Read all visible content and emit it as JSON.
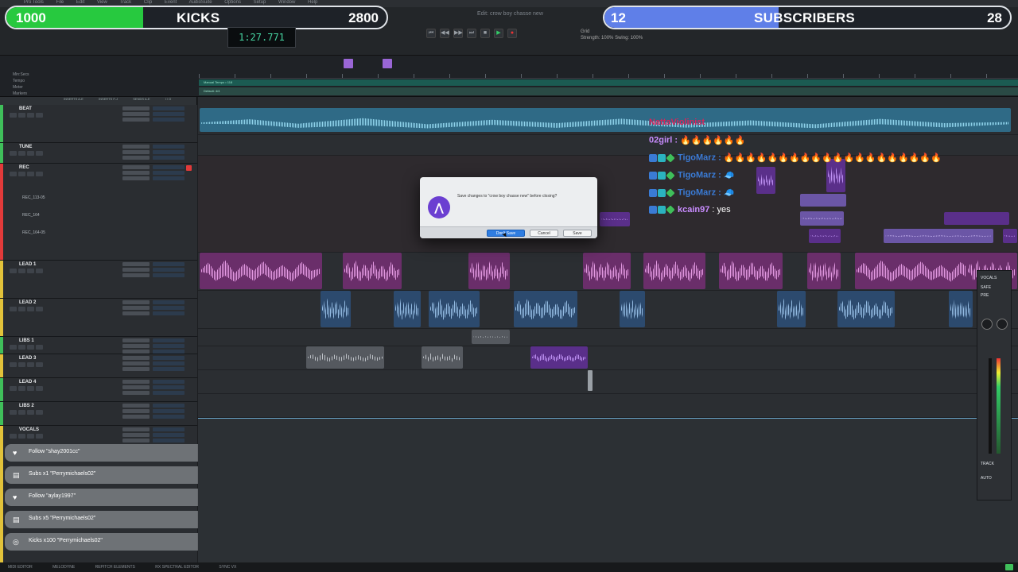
{
  "menu": [
    "Pro Tools",
    "File",
    "Edit",
    "View",
    "Track",
    "Clip",
    "Event",
    "AudioSuite",
    "Options",
    "Setup",
    "Window",
    "Help"
  ],
  "stats_left": {
    "left_value": "1000",
    "label": "KICKS",
    "right_value": "2800",
    "progress": 0.36,
    "color": "#27c93f"
  },
  "stats_right": {
    "left_value": "12",
    "label": "SUBSCRIBERS",
    "right_value": "28",
    "progress": 0.43,
    "color": "#5f7fe8"
  },
  "session_title": "Edit: crow boy chasse new",
  "main_counter": "1:27.771",
  "transport": [
    "⏮",
    "◀◀",
    "▶▶",
    "⏭",
    "■",
    "▶",
    "●"
  ],
  "grid_readout": [
    "Grid",
    "Strength:",
    "100%",
    "Swing:",
    "100%"
  ],
  "ruler_rows": [
    "Min:Secs",
    "Tempo",
    "Meter",
    "Markers"
  ],
  "ruler_sub": [
    "Manual Tempo • 118",
    "Default: 4/4"
  ],
  "mixer_columns": [
    "INSERTS A-E",
    "INSERTS F-J",
    "SENDS A-E",
    "I / O"
  ],
  "tracks": [
    {
      "name": "BEAT",
      "color": "#3fbf5a",
      "subs": []
    },
    {
      "name": "TUNE",
      "color": "#3fbf5a",
      "subs": []
    },
    {
      "name": "REC",
      "color": "#e23a3a",
      "subs": [
        "REC_113-05",
        "REC_164",
        "REC_164-05"
      ]
    },
    {
      "name": "LEAD 1",
      "color": "#e2c23a",
      "subs": []
    },
    {
      "name": "LEAD 2",
      "color": "#e2c23a",
      "subs": []
    },
    {
      "name": "LIBS 1",
      "color": "#3fbf5a",
      "subs": []
    },
    {
      "name": "LEAD 3",
      "color": "#e2c23a",
      "subs": []
    },
    {
      "name": "LEAD 4",
      "color": "#3fbf5a",
      "subs": []
    },
    {
      "name": "LIBS 2",
      "color": "#3fbf5a",
      "subs": []
    },
    {
      "name": "VOCALS",
      "color": "#e2c23a",
      "subs": []
    }
  ],
  "alerts": [
    {
      "icon": "heart-icon",
      "glyph": "♥",
      "text": "Follow \"shay2001cc\""
    },
    {
      "icon": "gift-icon",
      "glyph": "▤",
      "text": "Subs x1 \"Perrymichaels02\""
    },
    {
      "icon": "heart-icon",
      "glyph": "♥",
      "text": "Follow \"aylay1997\""
    },
    {
      "icon": "gift-icon",
      "glyph": "▤",
      "text": "Subs x5 \"Perrymichaels02\""
    },
    {
      "icon": "kick-icon",
      "glyph": "◎",
      "text": "Kicks x100 \"Perrymichaels02\""
    }
  ],
  "chat": [
    {
      "user": "NattaViolinist",
      "color": "#d9245b",
      "message": "",
      "badges": 0
    },
    {
      "user": "02girl",
      "color": "#c98cff",
      "message": "🔥🔥🔥🔥🔥🔥",
      "badges": 0
    },
    {
      "user": "TigoMarz",
      "color": "#3a7bd5",
      "message": "🔥🔥🔥🔥🔥🔥🔥🔥🔥🔥🔥🔥🔥🔥🔥🔥🔥🔥🔥🔥",
      "badges": 3
    },
    {
      "user": "TigoMarz",
      "color": "#3a7bd5",
      "message": "🧢",
      "badges": 3
    },
    {
      "user": "TigoMarz",
      "color": "#3a7bd5",
      "message": "🧢",
      "badges": 3
    },
    {
      "user": "kcain97",
      "color": "#c98cff",
      "message": "yes",
      "badges": 3
    }
  ],
  "dialog": {
    "message": "Save changes to \"crow boy chasse new\" before closing?",
    "dont_save": "Don't Save",
    "cancel": "Cancel",
    "save": "Save"
  },
  "right_panel": [
    "VOCALS",
    "SAFE",
    "PRE",
    "TRACK",
    "AUTO"
  ],
  "bottom_bar": [
    "MIDI EDITOR",
    "MELODYNE",
    "REPITCH ELEMENTS",
    "RX SPECTRAL EDITOR",
    "SYNC VX"
  ],
  "colors": {
    "beat": "#2f6a86",
    "lead": "#6a2e6a",
    "blue": "#2c4a6e",
    "accent": "#6b3fd1"
  }
}
